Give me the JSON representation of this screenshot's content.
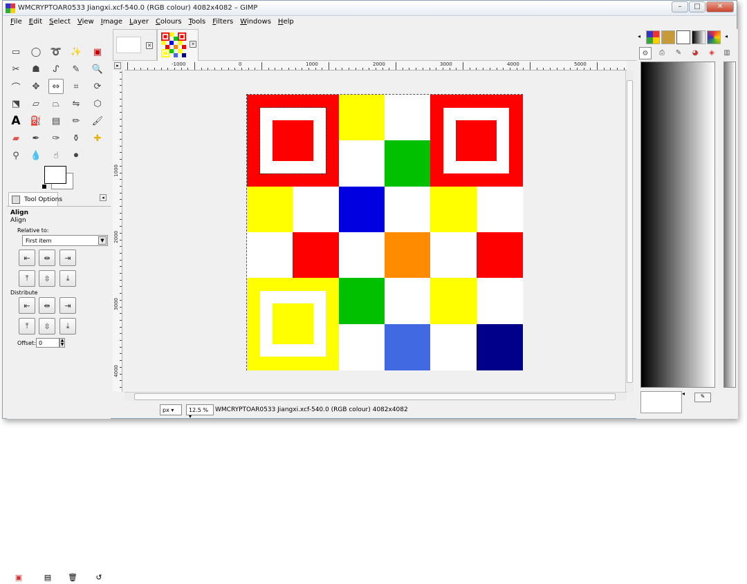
{
  "window": {
    "title": "WMCRYPTOAR0533 Jiangxi.xcf-540.0 (RGB colour) 4082x4082 – GIMP",
    "buttons": {
      "minimize": "–",
      "maximize": "□",
      "close": "✕"
    }
  },
  "menu": [
    "File",
    "Edit",
    "Select",
    "View",
    "Image",
    "Layer",
    "Colours",
    "Tools",
    "Filters",
    "Windows",
    "Help"
  ],
  "toolbox": {
    "tools": [
      "rect-select",
      "ellipse-select",
      "free-select",
      "fuzzy-select",
      "select-by-color",
      "scissors-select",
      "foreground-select",
      "paths",
      "color-picker",
      "zoom",
      "measure",
      "move",
      "align",
      "crop",
      "rotate",
      "scale",
      "shear",
      "perspective",
      "flip",
      "cage-transform",
      "text",
      "bucket-fill",
      "blend",
      "pencil",
      "paintbrush",
      "eraser",
      "airbrush",
      "ink",
      "clone",
      "heal",
      "perspective-clone",
      "blur",
      "smudge",
      "dodge-burn"
    ],
    "fg_color": "#ffffff",
    "bg_color": "#ffffff"
  },
  "tool_options": {
    "tab_label": "Tool Options",
    "heading": "Align",
    "subheading": "Align",
    "relative_to_label": "Relative to:",
    "relative_to_value": "First item",
    "distribute_label": "Distribute",
    "offset_label": "Offset:",
    "offset_value": "0"
  },
  "image_tabs": {
    "close_glyph": "✕"
  },
  "ruler": {
    "top_labels": [
      "-1000",
      "0",
      "1000",
      "2000",
      "3000",
      "4000",
      "5000"
    ],
    "left_labels": [
      "1000",
      "2000",
      "3000",
      "4000"
    ]
  },
  "image": {
    "grid_size": 6,
    "cells": [
      [
        "#ff0000",
        "#ff0000",
        "#ffff00",
        "#ffffff",
        "#ff0000",
        "#ff0000"
      ],
      [
        "#ff0000",
        "#ff0000",
        "#ffffff",
        "#00c000",
        "#ff0000",
        "#ff0000"
      ],
      [
        "#ffff00",
        "#ffffff",
        "#0000e0",
        "#ffffff",
        "#ffff00",
        "#ffffff"
      ],
      [
        "#ffffff",
        "#ff0000",
        "#ffffff",
        "#ff8c00",
        "#ffffff",
        "#ff0000"
      ],
      [
        "#ffff00",
        "#ffff00",
        "#00c000",
        "#ffffff",
        "#ffff00",
        "#ffffff"
      ],
      [
        "#ffff00",
        "#ffff00",
        "#ffffff",
        "#4169e1",
        "#ffffff",
        "#00008b"
      ]
    ],
    "finder_red": "#ff0000",
    "finder_yellow": "#ffff00"
  },
  "status": {
    "unit": "px",
    "zoom": "12.5 %",
    "text": "WMCRYPTOAR0533 Jiangxi.xcf-540.0 (RGB colour) 4082x4082"
  }
}
